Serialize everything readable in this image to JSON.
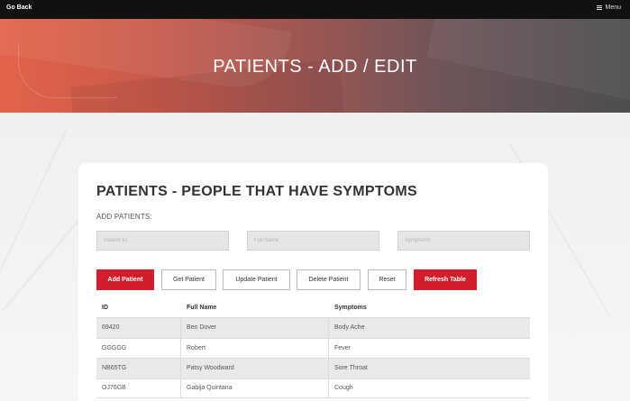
{
  "nav": {
    "back_label": "Go Back",
    "menu_label": "Menu"
  },
  "hero": {
    "title": "PATIENTS - ADD / EDIT"
  },
  "card": {
    "title": "PATIENTS - PEOPLE THAT HAVE SYMPTOMS",
    "subtitle": "ADD PATIENTS:"
  },
  "form": {
    "id_placeholder": "Patient ID",
    "name_placeholder": "Full Name",
    "symptoms_placeholder": "Symptoms"
  },
  "buttons": {
    "add": "Add Patient",
    "get": "Get Patient",
    "update": "Update Patient",
    "delete": "Delete Patient",
    "reset": "Reset",
    "refresh": "Refresh Table"
  },
  "table": {
    "headers": [
      "ID",
      "Full Name",
      "Symptoms"
    ],
    "rows": [
      [
        "69420",
        "Ben Dover",
        "Body Ache"
      ],
      [
        "GGGGG",
        "Robert",
        "Fever"
      ],
      [
        "NB65TG",
        "Patsy Woodward",
        "Sore Throat"
      ],
      [
        "OJ76GB",
        "Gabija Quintana",
        "Cough"
      ]
    ]
  },
  "colors": {
    "accent": "#d21e2b",
    "topbar": "#111111"
  }
}
